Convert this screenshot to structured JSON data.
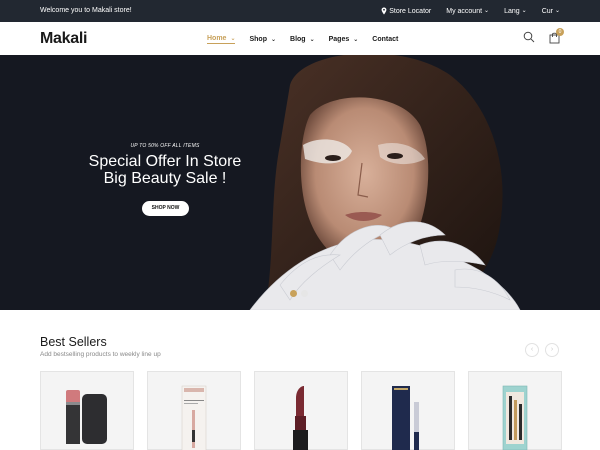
{
  "topbar": {
    "welcome": "Welcome you to Makali store!",
    "store_locator": "Store Locator",
    "account": "My account",
    "lang": "Lang",
    "cur": "Cur"
  },
  "header": {
    "logo": "Makali",
    "nav": [
      "Home",
      "Shop",
      "Blog",
      "Pages",
      "Contact"
    ],
    "active_nav": "Home",
    "cart_count": "0"
  },
  "hero": {
    "tagline": "UP TO 50% OFF ALL ITEMS",
    "title_line1": "Special Offer In Store",
    "title_line2": "Big Beauty Sale !",
    "button": "SHOP NOW",
    "slides": 2,
    "active_slide": 1
  },
  "best_sellers": {
    "title": "Best Sellers",
    "subtitle": "Add bestselling products to weekly line up",
    "prev": "‹",
    "next": "›",
    "products": [
      {
        "icon": "blush-stick-with-puff-icon"
      },
      {
        "icon": "eyeliner-box-icon"
      },
      {
        "icon": "lipstick-icon"
      },
      {
        "icon": "mascara-box-icon"
      },
      {
        "icon": "cosmetic-set-box-icon"
      }
    ]
  },
  "colors": {
    "accent": "#c8a15a",
    "topbar_bg": "#222831",
    "hero_bg": "#151821"
  }
}
